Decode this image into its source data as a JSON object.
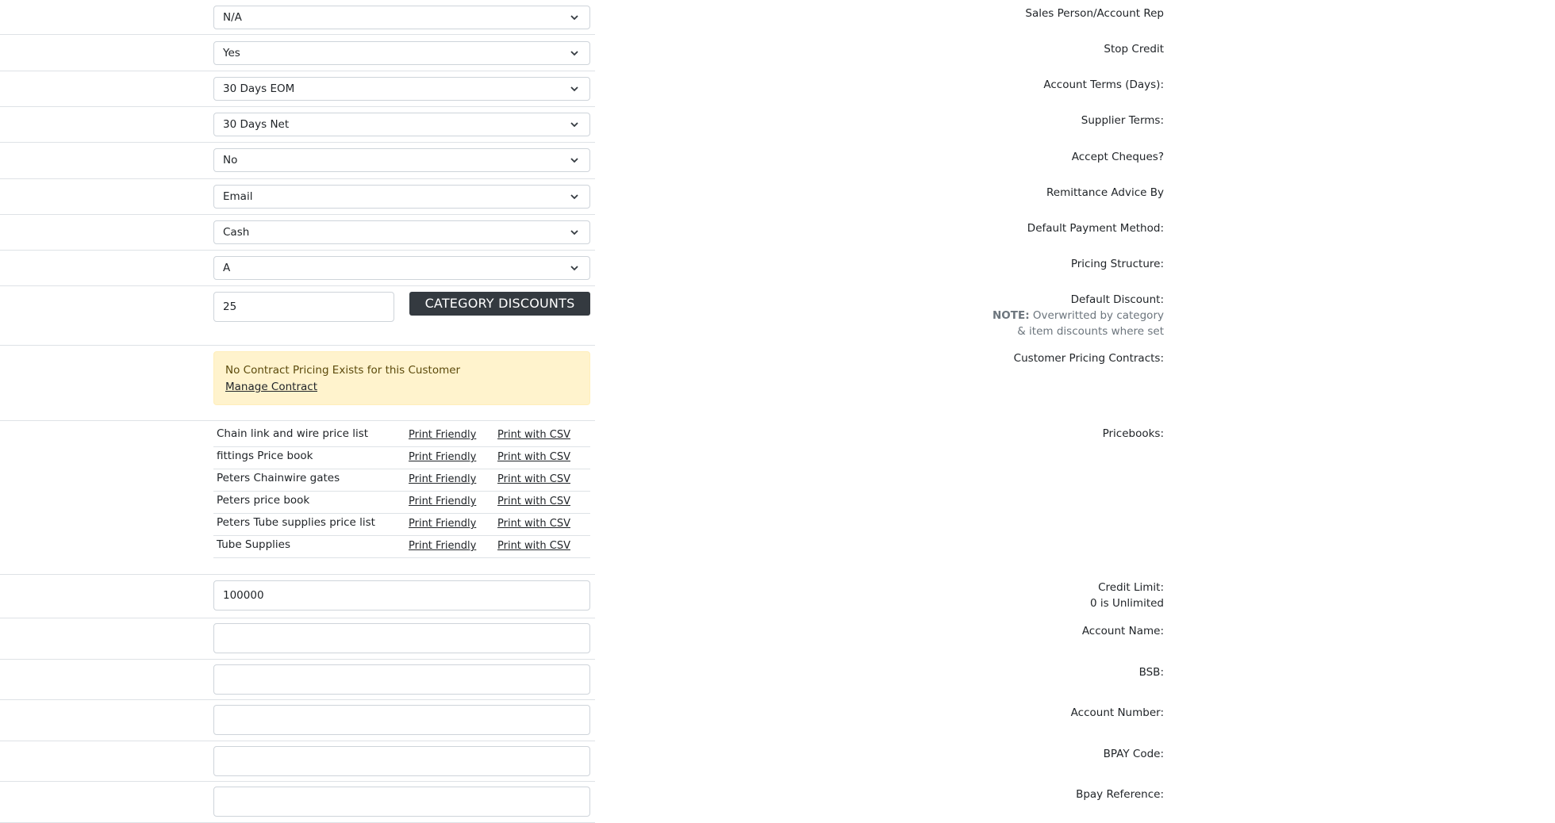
{
  "fields": {
    "sales_person": {
      "label": "Sales Person/Account Rep",
      "value": "N/A"
    },
    "stop_credit": {
      "label": "Stop Credit",
      "value": "Yes"
    },
    "account_terms": {
      "label": "Account Terms (Days):",
      "value": "30 Days EOM"
    },
    "supplier_terms": {
      "label": "Supplier Terms:",
      "value": "30 Days Net"
    },
    "accept_cheques": {
      "label": "Accept Cheques?",
      "value": "No"
    },
    "remittance_advice": {
      "label": "Remittance Advice By",
      "value": "Email"
    },
    "default_payment": {
      "label": "Default Payment Method:",
      "value": "Cash"
    },
    "pricing_structure": {
      "label": "Pricing Structure:",
      "value": "A"
    },
    "default_discount": {
      "label": "Default Discount:",
      "note_bold": "NOTE:",
      "note_line1": "Overwritted by category",
      "note_line2": "& item discounts where set",
      "value": "25",
      "button": "CATEGORY DISCOUNTS"
    },
    "pricing_contracts": {
      "label": "Customer Pricing Contracts:",
      "message": "No Contract Pricing Exists for this Customer",
      "link": "Manage Contract"
    },
    "pricebooks": {
      "label": "Pricebooks:",
      "print_friendly": "Print Friendly",
      "print_csv": "Print with CSV",
      "items": [
        {
          "name": "Chain link and wire price list"
        },
        {
          "name": "fittings Price book"
        },
        {
          "name": "Peters Chainwire gates"
        },
        {
          "name": "Peters price book"
        },
        {
          "name": "Peters Tube supplies price list"
        },
        {
          "name": "Tube Supplies"
        }
      ]
    },
    "credit_limit": {
      "label": "Credit Limit:",
      "note": "0 is Unlimited",
      "value": "100000"
    },
    "account_name": {
      "label": "Account Name:",
      "value": ""
    },
    "bsb": {
      "label": "BSB:",
      "value": ""
    },
    "account_number": {
      "label": "Account Number:",
      "value": ""
    },
    "bpay_code": {
      "label": "BPAY Code:",
      "value": ""
    },
    "bpay_reference": {
      "label": "Bpay Reference:",
      "value": ""
    }
  },
  "icons": {
    "select_chevron": "chevron-down-icon"
  }
}
